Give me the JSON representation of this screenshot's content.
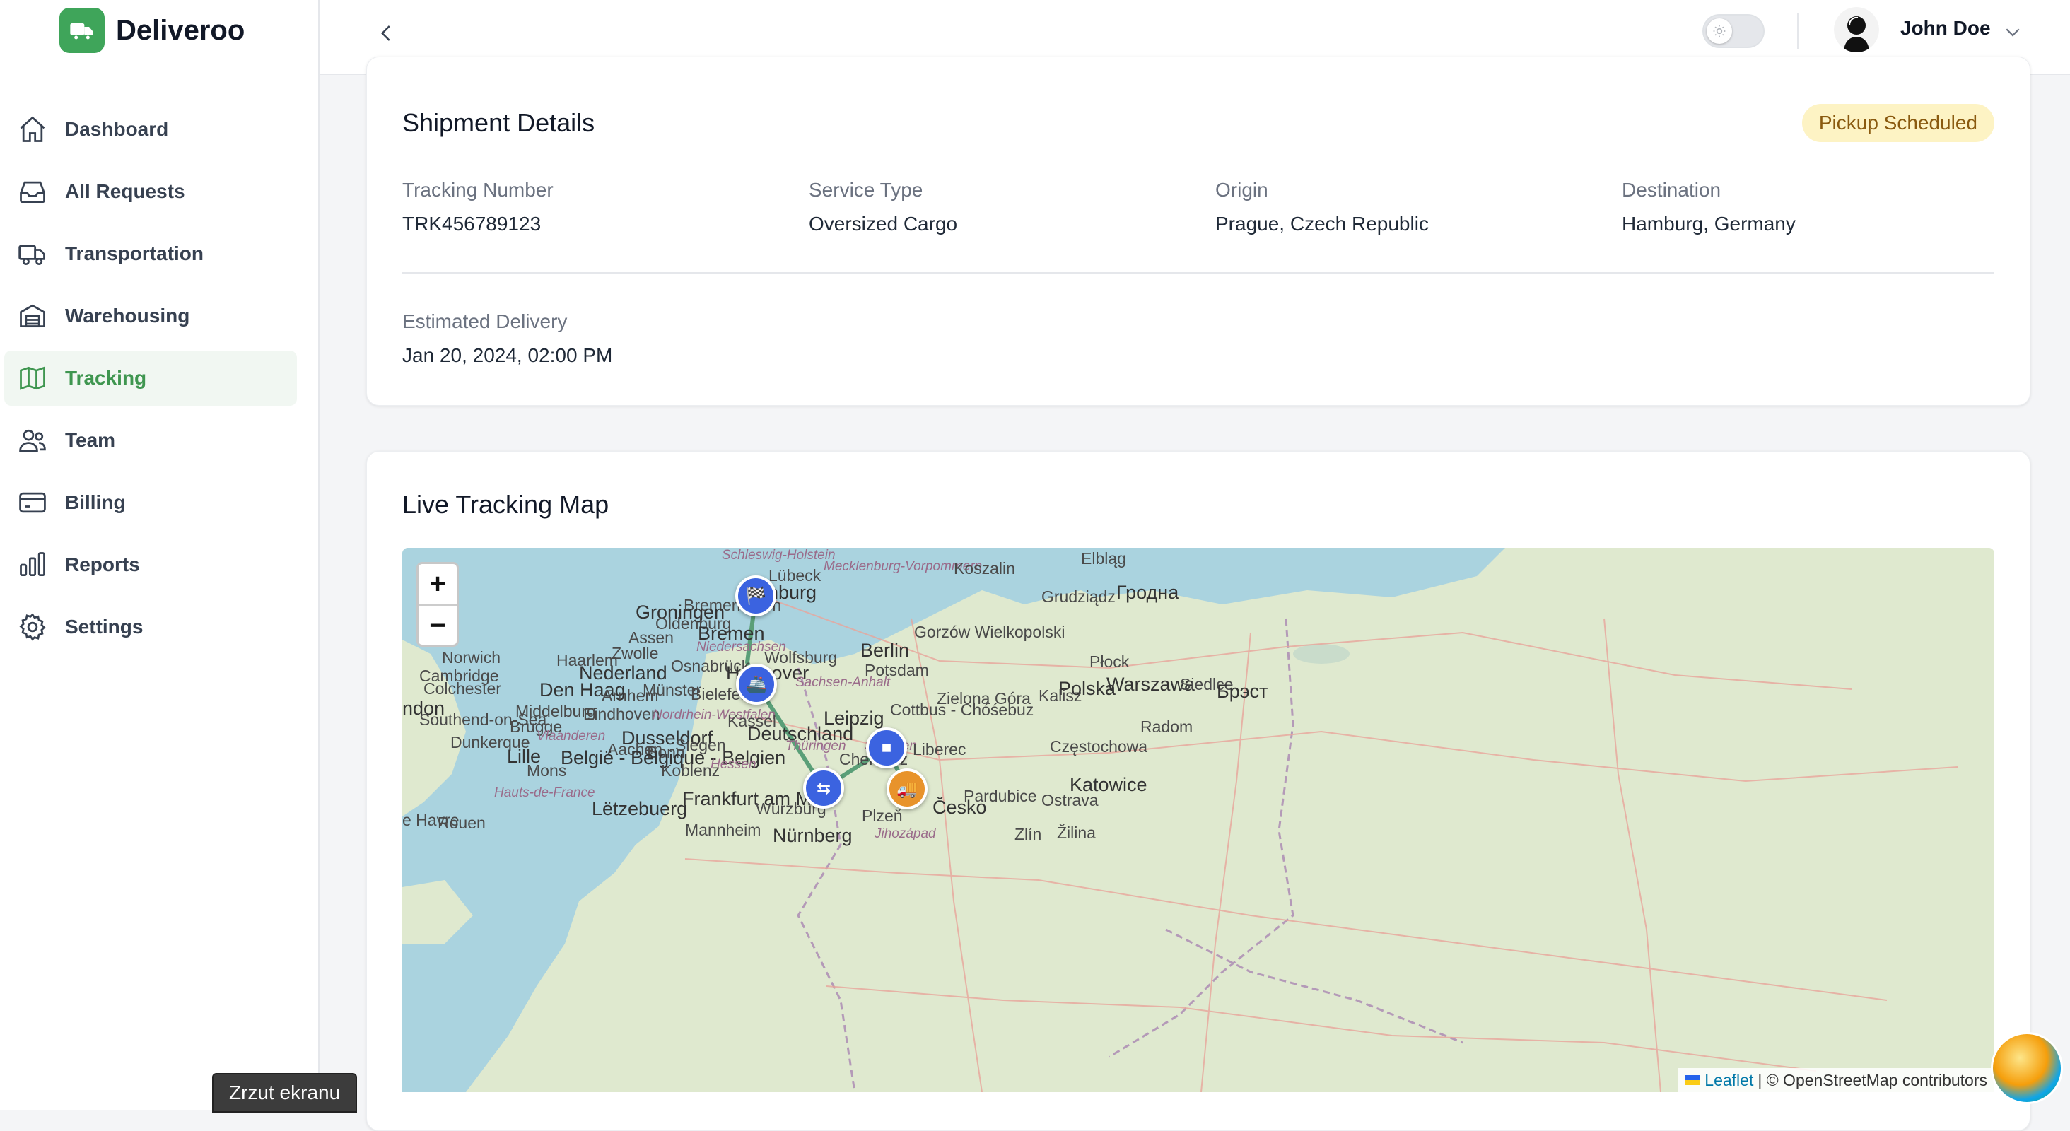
{
  "app": {
    "name": "Deliveroo"
  },
  "sidebar": {
    "items": [
      {
        "label": "Dashboard",
        "icon": "home-icon"
      },
      {
        "label": "All Requests",
        "icon": "inbox-icon"
      },
      {
        "label": "Transportation",
        "icon": "truck-icon"
      },
      {
        "label": "Warehousing",
        "icon": "warehouse-icon"
      },
      {
        "label": "Tracking",
        "icon": "map-icon",
        "active": true
      },
      {
        "label": "Team",
        "icon": "users-icon"
      },
      {
        "label": "Billing",
        "icon": "credit-card-icon"
      },
      {
        "label": "Reports",
        "icon": "bar-chart-icon"
      },
      {
        "label": "Settings",
        "icon": "gear-icon"
      }
    ]
  },
  "header": {
    "user_name": "John Doe"
  },
  "shipment": {
    "title": "Shipment Details",
    "status": "Pickup Scheduled",
    "tracking_number_label": "Tracking Number",
    "tracking_number": "TRK456789123",
    "service_type_label": "Service Type",
    "service_type": "Oversized Cargo",
    "origin_label": "Origin",
    "origin": "Prague, Czech Republic",
    "destination_label": "Destination",
    "destination": "Hamburg, Germany",
    "eta_label": "Estimated Delivery",
    "eta": "Jan 20, 2024, 02:00 PM"
  },
  "map": {
    "title": "Live Tracking Map",
    "zoom_in": "+",
    "zoom_out": "−",
    "attribution_leaflet": "Leaflet",
    "attribution_osm": "| © OpenStreetMap contributors",
    "labels": {
      "schleswig": "Schleswig-Holstein",
      "lubeck": "Lübeck",
      "mecklenburg": "Mecklenburg-Vorpommern",
      "koszalin": "Koszalin",
      "elblag": "Elbląg",
      "hamburg": "Hamburg",
      "bremerhaven": "Bremerhaven",
      "groningen": "Groningen",
      "oldenburg": "Oldenburg",
      "bremen": "Bremen",
      "assen": "Assen",
      "grudziadz": "Grudziądz",
      "grodno": "Гродна",
      "norwich": "Norwich",
      "zwolle": "Zwolle",
      "niedersachsen": "Niedersachsen",
      "wolfsburg": "Wolfsburg",
      "berlin": "Berlin",
      "gorzow": "Gorzów Wielkopolski",
      "haarlem": "Haarlem",
      "nederland": "Nederland",
      "osnabruck": "Osnabrück",
      "hannover": "Hannover",
      "potsdam": "Potsdam",
      "plock": "Płock",
      "cambridge": "Cambridge",
      "colchester": "Colchester",
      "denhaag": "Den Haag",
      "munster": "Münster",
      "bielefeld": "Bielefeld",
      "sachsenanhalt": "Sachsen-Anhalt",
      "polska": "Polska",
      "warszawa": "Warszawa",
      "siedlce": "Siedlce",
      "brest": "Брэст",
      "london": "ndon",
      "arnhem": "Arnhem",
      "kalisz": "Kalisz",
      "zielona": "Zielona Góra",
      "middelburg": "Middelburg",
      "southend": "Southend-on-Sea",
      "eindhoven": "Eindhoven",
      "nrw": "Nordrhein-Westfalen",
      "kassel": "Kassel",
      "leipzig": "Leipzig",
      "cottbus": "Cottbus - Chóśebuz",
      "brugge": "Brugge",
      "dusseldorf": "Dusseldorf",
      "deutschland": "Deutschland",
      "radom": "Radom",
      "dunkerque": "Dunkerque",
      "vlaanderen": "Vlaanderen",
      "siegen": "Siegen",
      "aachen": "Aachen",
      "bonn": "Bonn",
      "thuringen": "Thüringen",
      "sachsen": "Sachsen",
      "liberec": "Liberec",
      "czestochowa": "Częstochowa",
      "lille": "Lille",
      "belgie": "België - Belgique - Belgien",
      "chemnitz": "Chemnitz",
      "mons": "Mons",
      "koblenz": "Koblenz",
      "hessen": "Hessen",
      "katowice": "Katowice",
      "pardubice": "Pardubice",
      "frankfurt": "Frankfurt am Main",
      "ostrava": "Ostrava",
      "letzebuerg": "Lëtzebuerg",
      "wurzburg": "Würzburg",
      "plzen": "Plzeň",
      "cesko": "Česko",
      "lehavre": "e Havre",
      "rouen": "Rouen",
      "mannheim": "Mannheim",
      "nurnberg": "Nürnberg",
      "jihozapad": "Jihozápad",
      "zlin": "Zlín",
      "zilina": "Žilina",
      "hautsdefrance": "Hauts-de-France"
    }
  },
  "taskbar": {
    "screenshot_tooltip": "Zrzut ekranu"
  },
  "colors": {
    "brand": "#3fa55a",
    "route": "#5a9f78",
    "marker": "#3b63e0",
    "current_marker": "#e8932b",
    "badge_bg": "#fdf3c4"
  }
}
